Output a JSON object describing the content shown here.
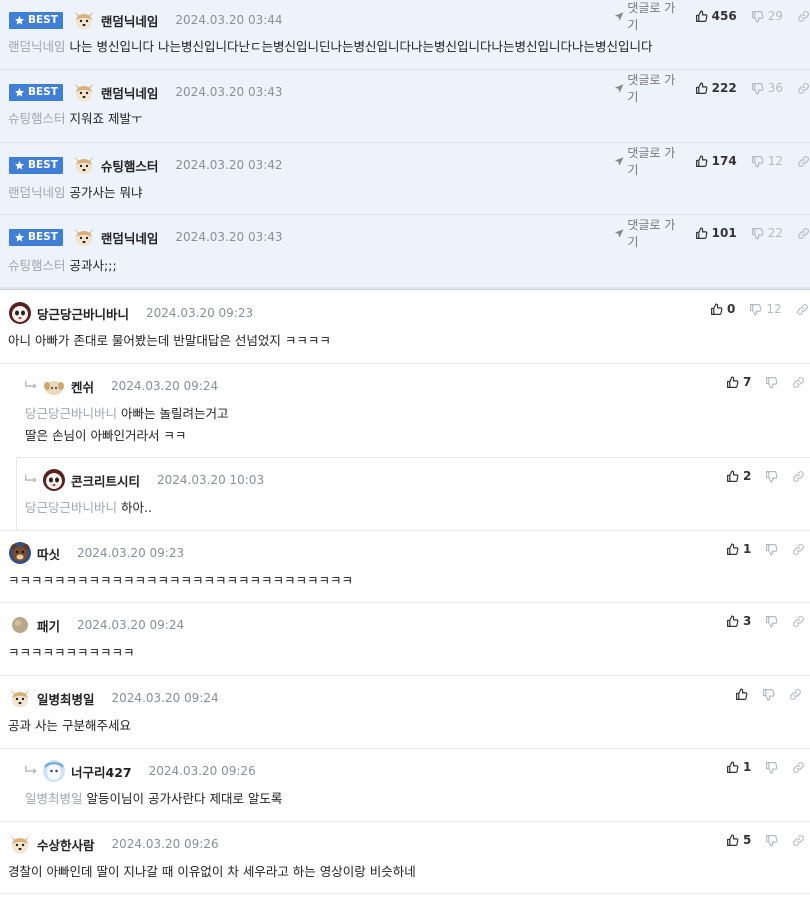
{
  "ui": {
    "best_label": "BEST",
    "goto_label": "댓글로 가기"
  },
  "colors": {
    "accent": "#3f7fd8",
    "best_bg": "#eef3fb",
    "muted": "#a1a6ae"
  },
  "best_comments": [
    {
      "nick": "랜덤닉네임",
      "date": "2024.03.20 03:44",
      "mention": "랜덤닉네임",
      "text": "나는 병신입니다 나는병신입니다난ㄷ는병신입니딘나는병신입니다나는병신입니다나는병신입니다나는병신입니다",
      "up": "456",
      "down": "29"
    },
    {
      "nick": "랜덤닉네임",
      "date": "2024.03.20 03:43",
      "mention": "슈팅햄스터",
      "text": "지워죠 제발ㅜ",
      "up": "222",
      "down": "36"
    },
    {
      "nick": "슈팅햄스터",
      "date": "2024.03.20 03:42",
      "mention": "랜덤닉네임",
      "text": "공가사는 뭐냐",
      "up": "174",
      "down": "12"
    },
    {
      "nick": "랜덤닉네임",
      "date": "2024.03.20 03:43",
      "mention": "슈팅햄스터",
      "text": "공과사;;;",
      "up": "101",
      "down": "22"
    }
  ],
  "comments": [
    {
      "nick": "당근당근바니바니",
      "date": "2024.03.20 09:23",
      "mention": "",
      "text": "아니 아빠가 존대로 물어봤는데 반말대답은 선넘었지 ㅋㅋㅋㅋ",
      "up": "0",
      "down": "12"
    },
    {
      "nick": "켄쉬",
      "date": "2024.03.20 09:24",
      "mention": "당근당근바니바니",
      "text": "아빠는 놀릴려는거고",
      "text2": "딸은 손님이 아빠인거라서 ㅋㅋ",
      "up": "7",
      "down": ""
    },
    {
      "nick": "콘크리트시티",
      "date": "2024.03.20 10:03",
      "mention": "당근당근바니바니",
      "text": "하아..",
      "up": "2",
      "down": ""
    },
    {
      "nick": "따싯",
      "date": "2024.03.20 09:23",
      "mention": "",
      "text": "ㅋㅋㅋㅋㅋㅋㅋㅋㅋㅋㅋㅋㅋㅋㅋㅋㅋㅋㅋㅋㅋㅋㅋㅋㅋㅋㅋㅋㅋㅋ",
      "up": "1",
      "down": ""
    },
    {
      "nick": "패기",
      "date": "2024.03.20 09:24",
      "mention": "",
      "text": "ㅋㅋㅋㅋㅋㅋㅋㅋㅋㅋㅋ",
      "up": "3",
      "down": ""
    },
    {
      "nick": "일병최병일",
      "date": "2024.03.20 09:24",
      "mention": "",
      "text": "공과 사는 구분해주세요",
      "up": "",
      "down": ""
    },
    {
      "nick": "너구리427",
      "date": "2024.03.20 09:26",
      "mention": "일병최병일",
      "text": "알등이님이 공가사란다 제대로 알도록",
      "up": "1",
      "down": ""
    },
    {
      "nick": "수상한사람",
      "date": "2024.03.20 09:26",
      "mention": "",
      "text": "경찰이 아빠인데 딸이 지나갈 때 이유없이 차 세우라고 하는 영상이랑 비슷하네",
      "up": "5",
      "down": ""
    }
  ]
}
